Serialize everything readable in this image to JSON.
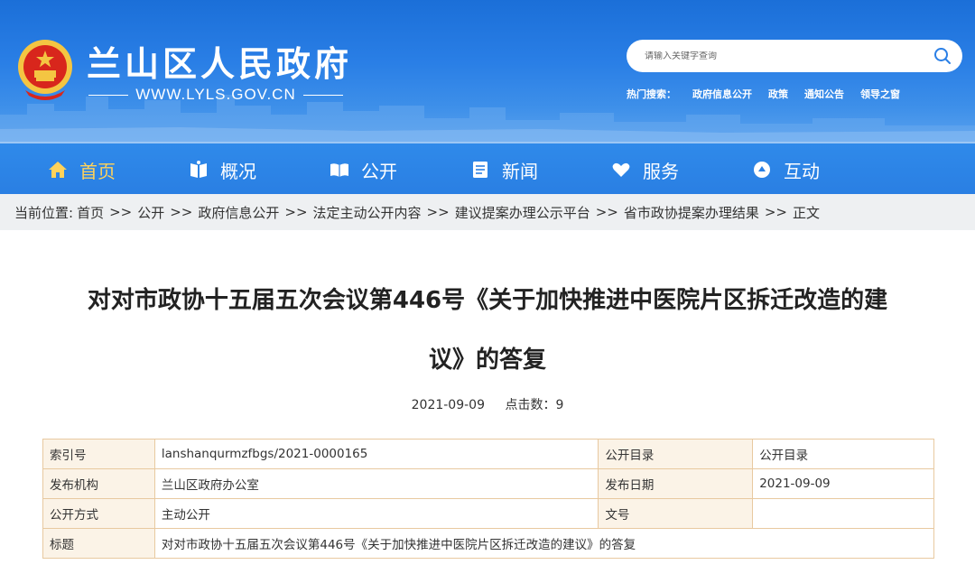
{
  "header": {
    "site_name": "兰山区人民政府",
    "site_url": "WWW.LYLS.GOV.CN",
    "search_placeholder": "请输入关键字查询",
    "hot_search_label": "热门搜索：",
    "hot_search_items": [
      "政府信息公开",
      "政策",
      "通知公告",
      "领导之窗"
    ]
  },
  "nav": {
    "items": [
      {
        "label": "首页",
        "icon": "home-icon"
      },
      {
        "label": "概况",
        "icon": "book-icon"
      },
      {
        "label": "公开",
        "icon": "open-book-icon"
      },
      {
        "label": "新闻",
        "icon": "document-icon"
      },
      {
        "label": "服务",
        "icon": "heart-hand-icon"
      },
      {
        "label": "互动",
        "icon": "chat-icon"
      }
    ]
  },
  "breadcrumb": {
    "prefix": "当前位置:",
    "separator": ">>",
    "items": [
      "首页",
      "公开",
      "政府信息公开",
      "法定主动公开内容",
      "建议提案办理公示平台",
      "省市政协提案办理结果",
      "正文"
    ]
  },
  "article": {
    "title_line1": "对对市政协十五届五次会议第446号《关于加快推进中医院片区拆迁改造的建",
    "title_line2": "议》的答复",
    "date": "2021-09-09",
    "clicks": "点击数：9"
  },
  "info_table": {
    "index_label": "索引号",
    "index_value": "lanshanqurmzfbgs/2021-0000165",
    "catalog_label": "公开目录",
    "catalog_value": "公开目录",
    "publisher_label": "发布机构",
    "publisher_value": "兰山区政府办公室",
    "pubdate_label": "发布日期",
    "pubdate_value": "2021-09-09",
    "method_label": "公开方式",
    "method_value": "主动公开",
    "docno_label": "文号",
    "docno_value": "",
    "subject_label": "标题",
    "subject_value": "对对市政协十五届五次会议第446号《关于加快推进中医院片区拆迁改造的建议》的答复"
  },
  "colors": {
    "header_blue": "#2a7fe6",
    "nav_active": "#ffd25a",
    "table_border": "#e8c9a0",
    "table_label_bg": "#fbf3e7"
  }
}
